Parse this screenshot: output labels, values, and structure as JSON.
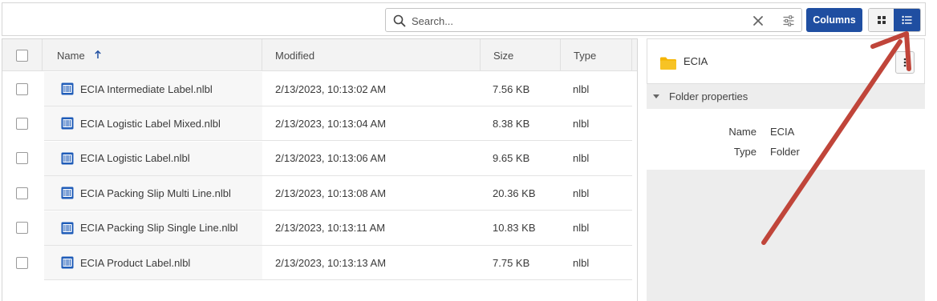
{
  "toolbar": {
    "search_placeholder": "Search...",
    "columns_label": "Columns",
    "icons": {
      "search": "search-icon",
      "clear": "close-icon",
      "filter": "filter-sliders-icon",
      "grid_view": "grid-view-icon",
      "list_view": "list-view-icon"
    },
    "active_view": "list"
  },
  "table": {
    "columns": [
      "Name",
      "Modified",
      "Size",
      "Type"
    ],
    "sort": {
      "column": "Name",
      "direction": "ascending",
      "icon": "arrow-up-icon"
    },
    "rows": [
      {
        "name": "ECIA Intermediate Label.nlbl",
        "modified": "2/13/2023, 10:13:02 AM",
        "size": "7.56 KB",
        "type": "nlbl"
      },
      {
        "name": "ECIA Logistic Label Mixed.nlbl",
        "modified": "2/13/2023, 10:13:04 AM",
        "size": "8.38 KB",
        "type": "nlbl"
      },
      {
        "name": "ECIA Logistic Label.nlbl",
        "modified": "2/13/2023, 10:13:06 AM",
        "size": "9.65 KB",
        "type": "nlbl"
      },
      {
        "name": "ECIA Packing Slip Multi Line.nlbl",
        "modified": "2/13/2023, 10:13:08 AM",
        "size": "20.36 KB",
        "type": "nlbl"
      },
      {
        "name": "ECIA Packing Slip Single Line.nlbl",
        "modified": "2/13/2023, 10:13:11 AM",
        "size": "10.83 KB",
        "type": "nlbl"
      },
      {
        "name": "ECIA Product Label.nlbl",
        "modified": "2/13/2023, 10:13:13 AM",
        "size": "7.75 KB",
        "type": "nlbl"
      }
    ],
    "file_icon": "barcode-label-file-icon"
  },
  "details": {
    "folder_name": "ECIA",
    "folder_icon": "folder-icon",
    "section_title": "Folder properties",
    "properties": [
      {
        "label": "Name",
        "value": "ECIA"
      },
      {
        "label": "Type",
        "value": "Folder"
      }
    ]
  },
  "colors": {
    "accent": "#1f4ea1",
    "folder": "#f5b400",
    "annotation_arrow": "#c0453a"
  }
}
